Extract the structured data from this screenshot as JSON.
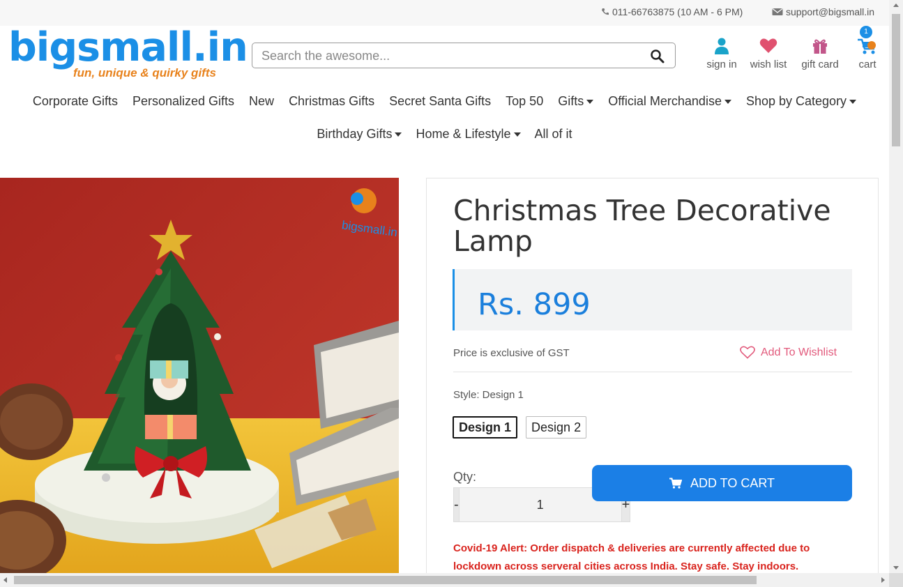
{
  "topbar": {
    "phone": "011-66763875 (10 AM - 6 PM)",
    "email": "support@bigsmall.in"
  },
  "logo": {
    "brand": "bigsmall.in",
    "tagline": "fun, unique & quirky gifts"
  },
  "search": {
    "placeholder": "Search the awesome..."
  },
  "account": {
    "signin": "sign in",
    "wishlist": "wish list",
    "giftcard": "gift card",
    "cart": "cart",
    "cart_count": "1"
  },
  "nav": {
    "row1": [
      "Corporate Gifts",
      "Personalized Gifts",
      "New",
      "Christmas Gifts",
      "Secret Santa Gifts",
      "Top 50",
      "Gifts",
      "Official Merchandise",
      "Shop by Category"
    ],
    "row2": [
      "Birthday Gifts",
      "Home & Lifestyle",
      "All of it"
    ]
  },
  "product": {
    "image_watermark": "bigsmall.in",
    "title": "Christmas Tree Decorative Lamp",
    "price": "Rs. 899",
    "gst_note": "Price is exclusive of GST",
    "add_to_wishlist": "Add To Wishlist",
    "style_label": "Style: Design 1",
    "styles": [
      "Design 1",
      "Design 2"
    ],
    "selected_style": "Design 1",
    "qty_label": "Qty:",
    "qty_value": "1",
    "qty_minus": "-",
    "qty_plus": "+",
    "add_to_cart": "ADD TO CART",
    "covid_alert": "Covid-19 Alert: Order dispatch & deliveries are currently affected due to lockdown across serveral cities across India. Stay safe. Stay indoors."
  },
  "colors": {
    "brand_blue": "#1b8fe6",
    "brand_orange": "#e8821c",
    "alert_red": "#d9231d",
    "wishlist_pink": "#e25a7c"
  },
  "icons": {
    "phone": "phone-icon",
    "email": "envelope-icon",
    "search": "search-icon",
    "signin": "user-icon",
    "wishlist": "heart-icon",
    "giftcard": "gift-icon",
    "cart": "cart-icon"
  }
}
